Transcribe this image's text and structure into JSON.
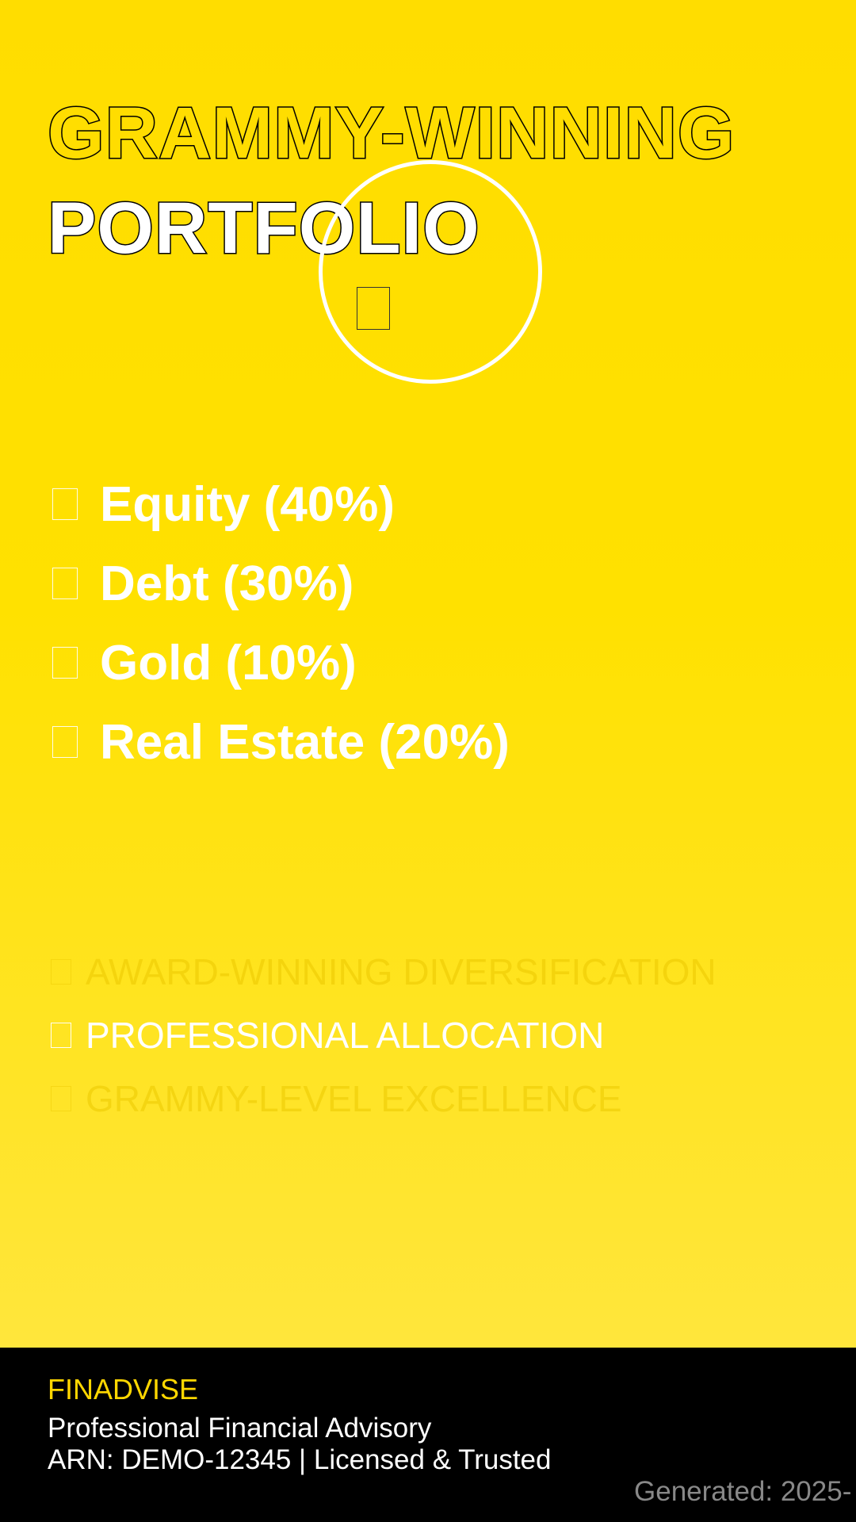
{
  "header": {
    "title_line_1": "GRAMMY-WINNING",
    "title_line_2": "PORTFOLIO",
    "emblem_icon": "unrendered-glyph-icon"
  },
  "allocation": [
    {
      "label": "Equity (40%)",
      "icon": "unrendered-glyph-icon"
    },
    {
      "label": "Debt (30%)",
      "icon": "unrendered-glyph-icon"
    },
    {
      "label": "Gold (10%)",
      "icon": "unrendered-glyph-icon"
    },
    {
      "label": "Real Estate (20%)",
      "icon": "unrendered-glyph-icon"
    }
  ],
  "features": [
    {
      "label": "AWARD-WINNING DIVERSIFICATION",
      "style": "faded"
    },
    {
      "label": "PROFESSIONAL ALLOCATION",
      "style": "highlighted"
    },
    {
      "label": "GRAMMY-LEVEL EXCELLENCE",
      "style": "faded"
    }
  ],
  "footer": {
    "brand": "FINADVISE",
    "tagline": "Professional Financial Advisory",
    "arn": "ARN: DEMO-12345 | Licensed & Trusted",
    "generated": "Generated: 2025-"
  },
  "colors": {
    "background_top": "#FFDD00",
    "background_bottom": "#FFE74A",
    "title_line_1_fill": "#FFDD00",
    "title_outline": "#000000",
    "text_primary": "#FFFFFF",
    "brand_accent": "#FFD700",
    "footer_background": "#000000",
    "footer_muted_text": "#888888"
  }
}
